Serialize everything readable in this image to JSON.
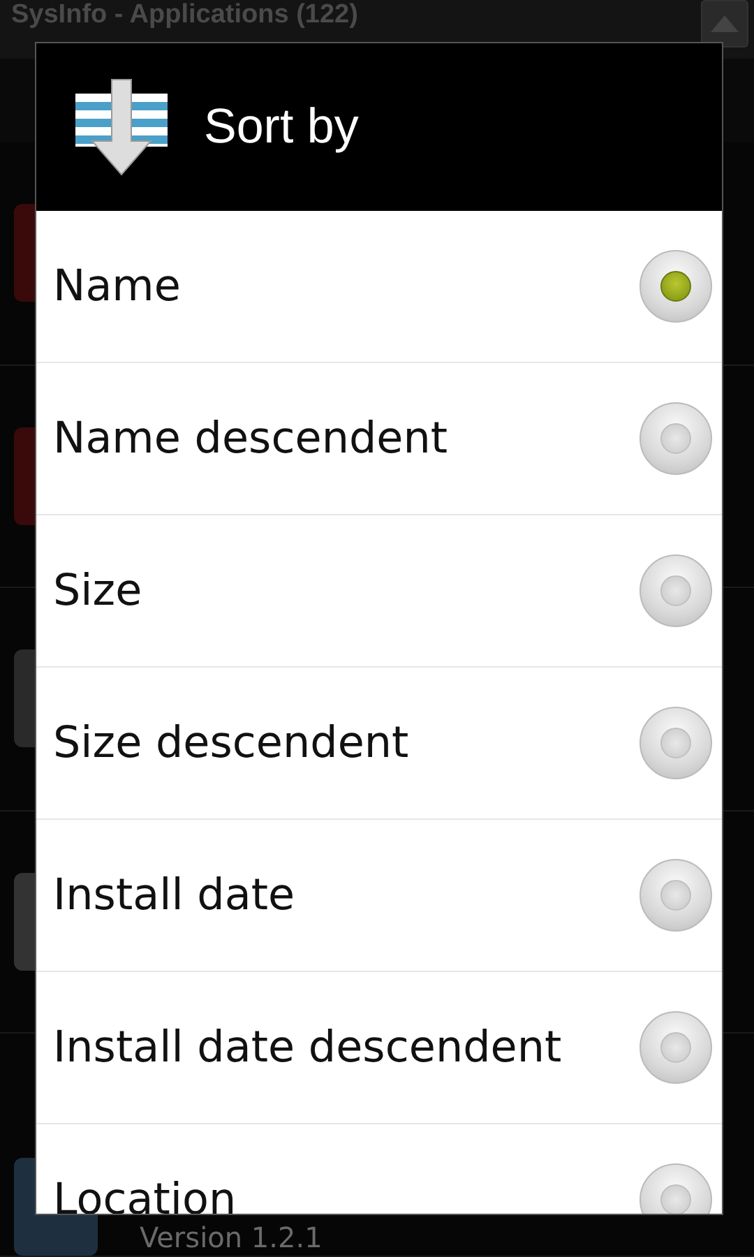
{
  "background": {
    "title": "SysInfo - Applications (122)",
    "footer_text": "Version 1.2.1"
  },
  "dialog": {
    "title": "Sort by",
    "options": [
      {
        "label": "Name",
        "selected": true
      },
      {
        "label": "Name descendent",
        "selected": false
      },
      {
        "label": "Size",
        "selected": false
      },
      {
        "label": "Size descendent",
        "selected": false
      },
      {
        "label": "Install date",
        "selected": false
      },
      {
        "label": "Install date descendent",
        "selected": false
      },
      {
        "label": "Location",
        "selected": false
      }
    ]
  }
}
